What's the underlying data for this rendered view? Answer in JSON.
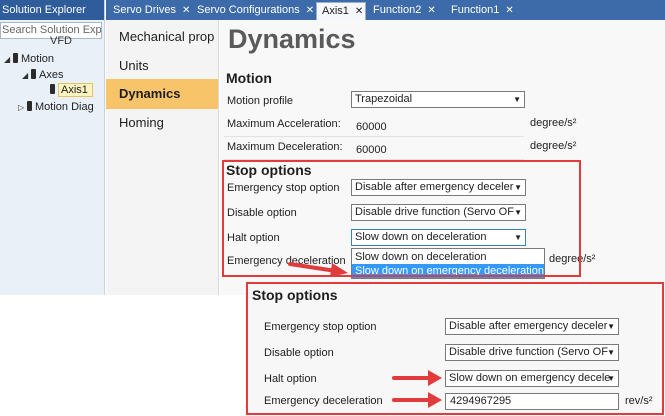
{
  "solution_explorer": {
    "title": "Solution Explorer",
    "search_placeholder": "Search Solution Explo",
    "items": [
      {
        "label": "VFD"
      },
      {
        "label": "Motion"
      },
      {
        "label": "Axes"
      },
      {
        "label": "Axis1"
      },
      {
        "label": "Motion Diag"
      }
    ]
  },
  "tabs": [
    {
      "label": "Servo Drives",
      "close": "✕"
    },
    {
      "label": "Servo Configurations",
      "close": "✕"
    },
    {
      "label": "Axis1",
      "close": "✕"
    },
    {
      "label": "Function2",
      "close": "✕"
    },
    {
      "label": "Function1",
      "close": "✕"
    }
  ],
  "categories": [
    {
      "label": "Mechanical prop"
    },
    {
      "label": "Units"
    },
    {
      "label": "Dynamics"
    },
    {
      "label": "Homing"
    }
  ],
  "page_title": "Dynamics",
  "motion": {
    "heading": "Motion",
    "profile_label": "Motion profile",
    "profile_value": "Trapezoidal",
    "max_acc_label": "Maximum Acceleration:",
    "max_acc_value": "60000",
    "max_acc_unit": "degree/s²",
    "max_dec_label": "Maximum Deceleration:",
    "max_dec_value": "60000",
    "max_dec_unit": "degree/s²"
  },
  "stop_options": {
    "heading": "Stop options",
    "emergency_label": "Emergency stop option",
    "emergency_value": "Disable after emergency deceler",
    "disable_label": "Disable option",
    "disable_value": "Disable drive function (Servo OF",
    "halt_label": "Halt option",
    "halt_value": "Slow down on deceleration",
    "emerg_decel_label": "Emergency deceleration",
    "emerg_decel_unit": "degree/s²",
    "dropdown_options": [
      "Slow down on deceleration",
      "Slow down on emergency deceleration"
    ]
  },
  "zoom": {
    "heading": "Stop options",
    "emergency_label": "Emergency stop option",
    "emergency_value": "Disable after emergency deceler",
    "disable_label": "Disable option",
    "disable_value": "Disable drive function (Servo OF",
    "halt_label": "Halt option",
    "halt_value": "Slow down on emergency decele",
    "emerg_decel_label": "Emergency deceleration",
    "emerg_decel_value": "4294967295",
    "emerg_decel_unit": "rev/s²"
  },
  "colors": {
    "accent_red": "#e23b3b",
    "tab_blue": "#3d6aa8",
    "selected_category": "#f7c46a",
    "dropdown_highlight": "#3399ff"
  }
}
